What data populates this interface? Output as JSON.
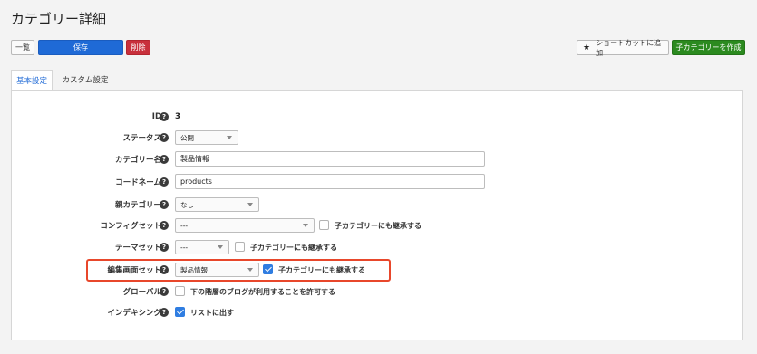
{
  "header": {
    "title": "カテゴリー詳細"
  },
  "toolbar": {
    "list_label": "一覧",
    "save_label": "保存",
    "delete_label": "削除",
    "shortcut_label": "ショートカットに追加",
    "create_child_label": "子カテゴリーを作成"
  },
  "tabs": [
    {
      "label": "基本設定",
      "active": true
    },
    {
      "label": "カスタム設定",
      "active": false
    }
  ],
  "form": {
    "id": {
      "label": "ID",
      "value": "3"
    },
    "status": {
      "label": "ステータス",
      "value": "公開"
    },
    "name": {
      "label": "カテゴリー名",
      "value": "製品情報"
    },
    "code": {
      "label": "コードネーム",
      "value": "products"
    },
    "parent": {
      "label": "親カテゴリー",
      "value": "なし"
    },
    "config": {
      "label": "コンフィグセット",
      "value": "---",
      "inherit_label": "子カテゴリーにも継承する",
      "inherit_checked": false
    },
    "theme": {
      "label": "テーマセット",
      "value": "---",
      "inherit_label": "子カテゴリーにも継承する",
      "inherit_checked": false
    },
    "editor": {
      "label": "編集画面セット",
      "value": "製品情報",
      "inherit_label": "子カテゴリーにも継承する",
      "inherit_checked": true
    },
    "global": {
      "label": "グローバル",
      "checkbox_label": "下の階層のブログが利用することを許可する",
      "checked": false
    },
    "indexing": {
      "label": "インデキシング",
      "checkbox_label": "リストに出す",
      "checked": true
    }
  },
  "colors": {
    "accent": "#1f6ad6",
    "danger": "#c8303c",
    "success": "#2b8a1f",
    "highlight": "#e8472b"
  }
}
